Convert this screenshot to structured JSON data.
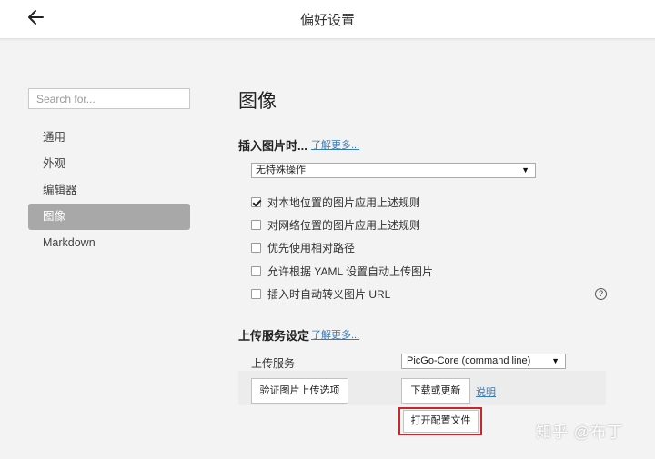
{
  "window": {
    "title": "偏好设置"
  },
  "search": {
    "placeholder": "Search for..."
  },
  "sidebar": {
    "items": [
      {
        "label": "通用",
        "active": false
      },
      {
        "label": "外观",
        "active": false
      },
      {
        "label": "编辑器",
        "active": false
      },
      {
        "label": "图像",
        "active": true
      },
      {
        "label": "Markdown",
        "active": false
      }
    ]
  },
  "main": {
    "title": "图像",
    "insert": {
      "title": "插入图片时...",
      "learn_more": "了解更多...",
      "action_select": "无特殊操作",
      "options": [
        {
          "label": "对本地位置的图片应用上述规则",
          "checked": true
        },
        {
          "label": "对网络位置的图片应用上述规则",
          "checked": false
        },
        {
          "label": "优先使用相对路径",
          "checked": false
        },
        {
          "label": "允许根据 YAML 设置自动上传图片",
          "checked": false
        },
        {
          "label": "插入时自动转义图片 URL",
          "checked": false
        }
      ],
      "help_icon": "?"
    },
    "upload": {
      "title": "上传服务设定",
      "learn_more": "了解更多...",
      "service_label": "上传服务",
      "service_select": "PicGo-Core (command line)",
      "verify_button": "验证图片上传选项",
      "download_button": "下载或更新",
      "help_link": "说明",
      "open_config_button": "打开配置文件"
    }
  },
  "watermark": "知乎 @布丁",
  "colors": {
    "highlight": "#c8262c",
    "link": "#3a7ab8",
    "active_nav": "#a8a8a8"
  }
}
